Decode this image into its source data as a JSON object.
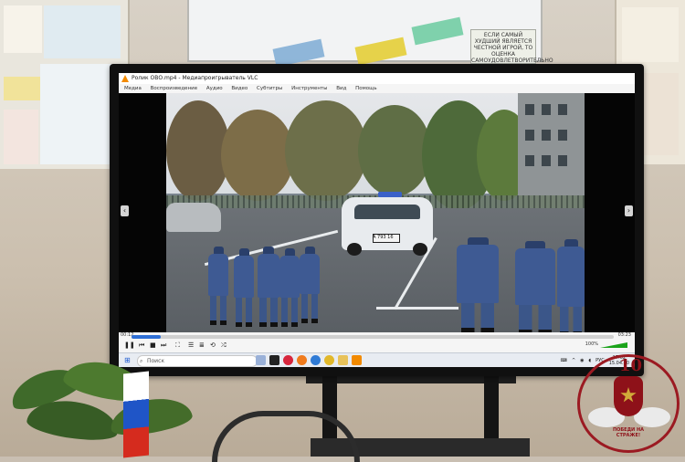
{
  "posters": {
    "whiteboard_sign_text": "ЕСЛИ САМЫЙ ХУДШИЙ ЯВЛЯЕТСЯ ЧЕСТНОЙ ИГРОЙ, ТО ОЦЕНКА САМОУДОВЛЕТВОРИТЕЛЬНО"
  },
  "vlc": {
    "title": "Ролик ОВО.mp4 - Медиапроигрыватель VLC",
    "menu": [
      "Медиа",
      "Воспроизведение",
      "Аудио",
      "Видео",
      "Субтитры",
      "Инструменты",
      "Вид",
      "Помощь"
    ],
    "time_current": "00:12",
    "time_total": "03:23",
    "progress_percent": 6,
    "volume_percent": "100%"
  },
  "video": {
    "plate_text": "А 793 16"
  },
  "taskbar": {
    "search_placeholder": "Поиск",
    "language": "РУС",
    "time": "17:02",
    "date": "15.04.20"
  },
  "emblem": {
    "number": "10",
    "motto": "ПОБЕДИ НА СТРАЖЕ!"
  },
  "icons": {
    "vlc_cone": "traffic-cone",
    "start": "windows-logo",
    "search": "magnifier",
    "play": "pause"
  },
  "colors": {
    "accent_blue": "#2e6fd6",
    "vlc_orange": "#f28a00",
    "uniform_blue": "#3e5a93",
    "emblem_red": "#8e1119"
  }
}
